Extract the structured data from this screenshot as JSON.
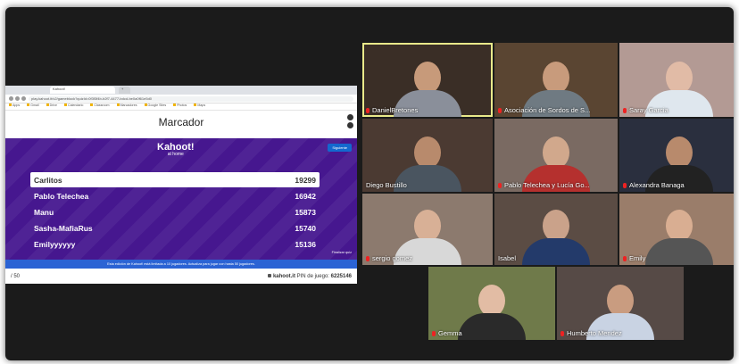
{
  "browser": {
    "tab_title": "Kahoot!",
    "url": "play.kahoot.it/v2/gameblock?quizId=0f3f3f4b-b2f7-4477-bdcd-be0a0f61e5d0",
    "bookmarks": [
      "Apps",
      "Gmail",
      "Drive",
      "Calendario",
      "Classroom",
      "Marcadores",
      "Google Sites",
      "Photos",
      "Maps"
    ]
  },
  "kahoot": {
    "title": "Marcador",
    "brand": "Kahoot!",
    "brand_sub": "at home",
    "next_label": "Siguiente",
    "leaderboard": [
      {
        "name": "Carlitos",
        "score": "19299"
      },
      {
        "name": "Pablo Telechea",
        "score": "16942"
      },
      {
        "name": "Manu",
        "score": "15873"
      },
      {
        "name": "Sasha-MafiaRus",
        "score": "15740"
      },
      {
        "name": "Emilyyyyyy",
        "score": "15136"
      }
    ],
    "end_quiz_label": "Finalizar quiz",
    "footer_notice": "Esta edición de Kahoot! está limitada a 10 jugadores. Actualiza para jugar con hasta 50 jugadores.",
    "progress": "/ 50",
    "site": "kahoot.it",
    "pin_label": "PIN de juego:",
    "pin_value": "6225146"
  },
  "participants": [
    {
      "name": "DanielBretones"
    },
    {
      "name": "Asociación de Sordos de S..."
    },
    {
      "name": "Saray Garcia"
    },
    {
      "name": "Diego Bustillo"
    },
    {
      "name": "Pablo Telechea y Lucía Go..."
    },
    {
      "name": "Alexandra Banaga"
    },
    {
      "name": "sergio gomez"
    },
    {
      "name": "Isabel"
    },
    {
      "name": "Emily"
    },
    {
      "name": "Gemma"
    },
    {
      "name": "Humberto Mendez"
    }
  ],
  "colors": {
    "kahoot_purple": "#46178f",
    "active_speaker": "#e9e98a",
    "muted_mic": "#e22222"
  }
}
